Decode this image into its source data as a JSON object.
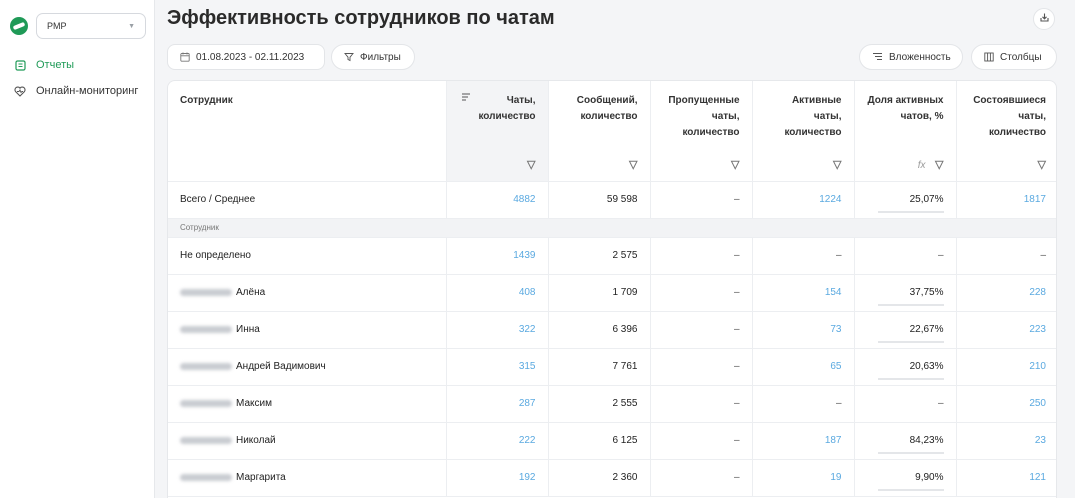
{
  "sidebar": {
    "project": "PMP",
    "items": [
      {
        "label": "Отчеты",
        "active": true,
        "icon": "reports-icon"
      },
      {
        "label": "Онлайн-мониторинг",
        "active": false,
        "icon": "heart-monitor-icon"
      }
    ]
  },
  "header": {
    "title": "Эффективность сотрудников по чатам"
  },
  "toolbar": {
    "date_range": "01.08.2023 - 02.11.2023",
    "filters_label": "Фильтры",
    "nesting_label": "Вложенность",
    "columns_label": "Столбцы"
  },
  "table": {
    "columns": [
      "Сотрудник",
      "Чаты, количество",
      "Сообщений, количество",
      "Пропущенные чаты, количество",
      "Активные чаты, количество",
      "Доля активных чатов, %",
      "Состоявшиеся чаты, количество"
    ],
    "fx_label": "fx",
    "total": {
      "name": "Всего / Среднее",
      "chats": "4882",
      "messages": "59 598",
      "missed": "–",
      "active": "1224",
      "share": "25,07%",
      "share_value": 25.07,
      "held": "1817"
    },
    "group_label": "Сотрудник",
    "rows": [
      {
        "name": "Не определено",
        "chats": "1439",
        "messages": "2 575",
        "missed": "–",
        "active": "–",
        "share": "–",
        "share_value": null,
        "held": "–"
      },
      {
        "name": "Алёна",
        "chats": "408",
        "messages": "1 709",
        "missed": "–",
        "active": "154",
        "share": "37,75%",
        "share_value": 37.75,
        "held": "228"
      },
      {
        "name": "Инна",
        "chats": "322",
        "messages": "6 396",
        "missed": "–",
        "active": "73",
        "share": "22,67%",
        "share_value": 22.67,
        "held": "223"
      },
      {
        "name": "Андрей Вадимович",
        "chats": "315",
        "messages": "7 761",
        "missed": "–",
        "active": "65",
        "share": "20,63%",
        "share_value": 20.63,
        "held": "210"
      },
      {
        "name": "Максим",
        "chats": "287",
        "messages": "2 555",
        "missed": "–",
        "active": "–",
        "share": "–",
        "share_value": null,
        "held": "250"
      },
      {
        "name": "Николай",
        "chats": "222",
        "messages": "6 125",
        "missed": "–",
        "active": "187",
        "share": "84,23%",
        "share_value": 84.23,
        "held": "23"
      },
      {
        "name": "Маргарита",
        "chats": "192",
        "messages": "2 360",
        "missed": "–",
        "active": "19",
        "share": "9,90%",
        "share_value": 9.9,
        "held": "121"
      }
    ]
  },
  "colors": {
    "accent": "#1f9a57",
    "link": "#5aa9e0",
    "bar": "#2aa55f"
  }
}
